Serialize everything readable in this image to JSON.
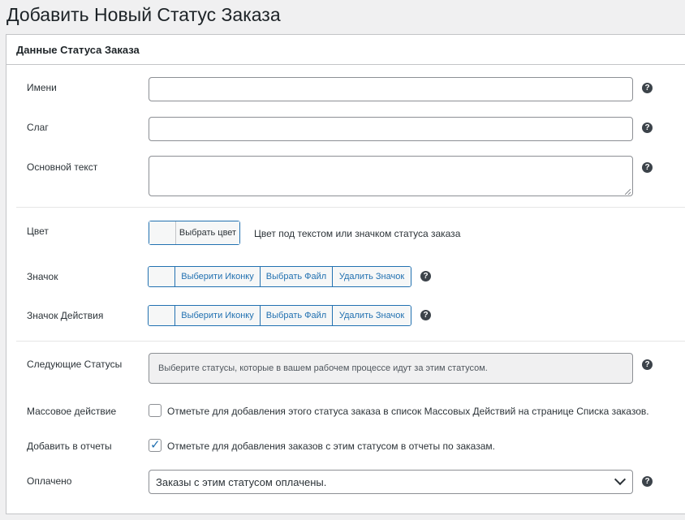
{
  "page": {
    "title": "Добавить Новый Статус Заказа"
  },
  "panel": {
    "title": "Данные Статуса Заказа"
  },
  "fields": {
    "name": {
      "label": "Имени",
      "value": "",
      "help_icon": "question-circle-icon"
    },
    "slug": {
      "label": "Слаг",
      "value": "",
      "help_icon": "question-circle-icon"
    },
    "body_text": {
      "label": "Основной текст",
      "value": "",
      "help_icon": "question-circle-icon"
    },
    "color": {
      "label": "Цвет",
      "button_label": "Выбрать цвет",
      "description": "Цвет под текстом или значком статуса заказа",
      "swatch_color": "#f6f7f7"
    },
    "icon": {
      "label": "Значок",
      "buttons": [
        "Выберити Иконку",
        "Выбрать Файл",
        "Удалить Значок"
      ]
    },
    "action_icon": {
      "label": "Значок Действия",
      "buttons": [
        "Выберити Иконку",
        "Выбрать Файл",
        "Удалить Значок"
      ]
    },
    "next_statuses": {
      "label": "Следующие Статусы",
      "placeholder": "Выберите статусы, которые в вашем рабочем процессе идут за этим статусом."
    },
    "bulk_action": {
      "label": "Массовое действие",
      "checked": false,
      "description": "Отметьте для добавления этого статуса заказа в список Массовых Действий на странице Списка заказов."
    },
    "add_to_reports": {
      "label": "Добавить в отчеты",
      "checked": true,
      "description": "Отметьте для добавления заказов с этим статусом в отчеты по заказам."
    },
    "paid": {
      "label": "Оплачено",
      "selected": "Заказы с этим статусом оплачены."
    }
  },
  "colors": {
    "accent": "#2271b1",
    "border": "#8c8f94",
    "background": "#f0f0f1"
  }
}
